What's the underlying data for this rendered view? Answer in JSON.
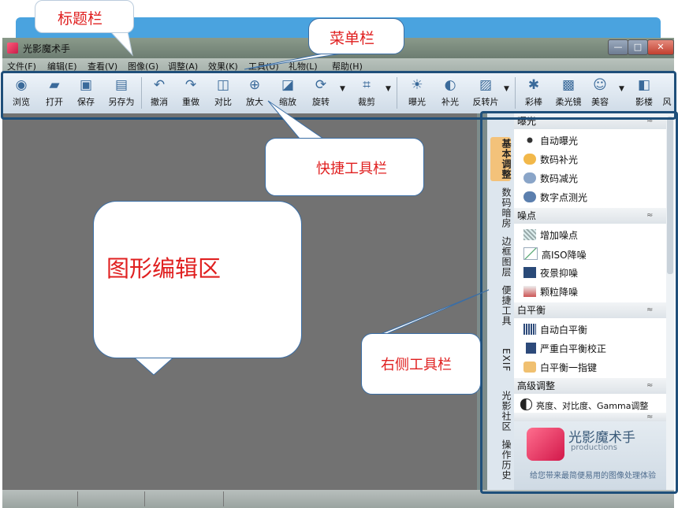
{
  "annotations": {
    "title_bar": "标题栏",
    "menu_bar": "菜单栏",
    "quick_toolbar": "快捷工具栏",
    "edit_area": "图形编辑区",
    "right_toolbar": "右侧工具栏"
  },
  "window": {
    "title": "光影魔术手",
    "minimize": "—",
    "maximize": "□",
    "close": "✕"
  },
  "menu": [
    "文件(F)",
    "编辑(E)",
    "查看(V)",
    "图像(G)",
    "调整(A)",
    "效果(K)",
    "工具(U)",
    "礼物(L)",
    "帮助(H)"
  ],
  "toolbar": [
    {
      "label": "浏览",
      "icon": "eye-icon",
      "glyph": "◉"
    },
    {
      "label": "打开",
      "icon": "folder-icon",
      "glyph": "▰"
    },
    {
      "label": "保存",
      "icon": "save-icon",
      "glyph": "▣"
    },
    {
      "label": "另存为",
      "icon": "save-as-icon",
      "glyph": "▤"
    },
    {
      "label": "撤消",
      "icon": "undo-icon",
      "glyph": "↶"
    },
    {
      "label": "重做",
      "icon": "redo-icon",
      "glyph": "↷"
    },
    {
      "label": "对比",
      "icon": "compare-icon",
      "glyph": "◫"
    },
    {
      "label": "放大",
      "icon": "zoom-in-icon",
      "glyph": "⊕"
    },
    {
      "label": "缩放",
      "icon": "resize-icon",
      "glyph": "◪"
    },
    {
      "label": "旋转",
      "icon": "rotate-icon",
      "glyph": "⟳"
    },
    {
      "label": "裁剪",
      "icon": "crop-icon",
      "glyph": "⌗"
    },
    {
      "label": "曝光",
      "icon": "exposure-icon",
      "glyph": "☀"
    },
    {
      "label": "补光",
      "icon": "fill-light-icon",
      "glyph": "◐"
    },
    {
      "label": "反转片",
      "icon": "reversal-film-icon",
      "glyph": "▨"
    },
    {
      "label": "彩棒",
      "icon": "color-wand-icon",
      "glyph": "✱"
    },
    {
      "label": "柔光镜",
      "icon": "soft-light-icon",
      "glyph": "▩"
    },
    {
      "label": "美容",
      "icon": "beauty-icon",
      "glyph": "☺"
    },
    {
      "label": "影楼",
      "icon": "studio-icon",
      "glyph": "◧"
    },
    {
      "label": "风",
      "icon": "wind-icon",
      "glyph": ""
    }
  ],
  "side_tabs": [
    "基本调整",
    "数码暗房",
    "边框图层",
    "便捷工具",
    "EXIF",
    "光影社区",
    "操作历史"
  ],
  "panel": {
    "sections": [
      {
        "title": "曝光",
        "items": [
          "自动曝光",
          "数码补光",
          "数码减光",
          "数字点测光"
        ]
      },
      {
        "title": "噪点",
        "items": [
          "增加噪点",
          "高ISO降噪",
          "夜景抑噪",
          "颗粒降噪"
        ]
      },
      {
        "title": "白平衡",
        "items": [
          "自动白平衡",
          "严重白平衡校正",
          "白平衡一指键"
        ]
      },
      {
        "title": "高级调整",
        "items": [
          "亮度、对比度、Gamma调整"
        ]
      }
    ],
    "collapse_glyph": "≈"
  },
  "logo": {
    "name": "光影魔术手",
    "productions": "productions",
    "slogan": "给您带来最简便易用的图像处理体验"
  },
  "colors": {
    "annotation_text": "#e02020",
    "highlight_border": "#1f4f7a",
    "header_band": "#4aa3df"
  }
}
